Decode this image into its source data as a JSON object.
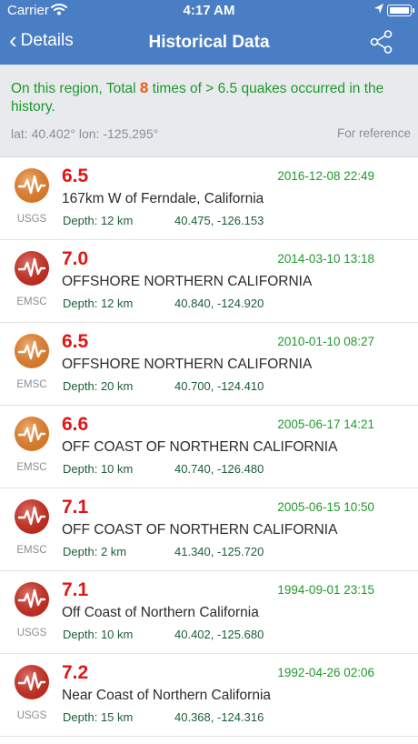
{
  "status_bar": {
    "carrier": "Carrier",
    "time": "4:17 AM"
  },
  "nav": {
    "back_label": "Details",
    "title": "Historical Data"
  },
  "summary": {
    "prefix": "On this region, Total",
    "count": "8",
    "suffix": "times of > 6.5 quakes occurred in the history.",
    "coords": "lat: 40.402°  lon: -125.295°",
    "reference": "For reference"
  },
  "colors": {
    "nav_bar": "#4a7ec4",
    "magnitude": "#e01515",
    "datetime": "#1e9a2a",
    "count": "#f05a10",
    "icon_orange": "#f5862a",
    "icon_red": "#d62c1e"
  },
  "quakes": [
    {
      "mag": "6.5",
      "datetime": "2016-12-08 22:49",
      "place": "167km W of Ferndale, California",
      "depth_label": "Depth:",
      "depth": "12 km",
      "location": "40.475, -126.153",
      "source": "USGS",
      "icon": "orange-quake-icon"
    },
    {
      "mag": "7.0",
      "datetime": "2014-03-10 13:18",
      "place": "OFFSHORE NORTHERN CALIFORNIA",
      "depth_label": "Depth:",
      "depth": "12 km",
      "location": "40.840, -124.920",
      "source": "EMSC",
      "icon": "red-quake-icon"
    },
    {
      "mag": "6.5",
      "datetime": "2010-01-10 08:27",
      "place": "OFFSHORE NORTHERN CALIFORNIA",
      "depth_label": "Depth:",
      "depth": "20 km",
      "location": "40.700, -124.410",
      "source": "EMSC",
      "icon": "orange-quake-icon"
    },
    {
      "mag": "6.6",
      "datetime": "2005-06-17 14:21",
      "place": "OFF COAST OF NORTHERN CALIFORNIA",
      "depth_label": "Depth:",
      "depth": "10 km",
      "location": "40.740, -126.480",
      "source": "EMSC",
      "icon": "orange-quake-icon"
    },
    {
      "mag": "7.1",
      "datetime": "2005-06-15 10:50",
      "place": "OFF COAST OF NORTHERN CALIFORNIA",
      "depth_label": "Depth:",
      "depth": "2 km",
      "location": "41.340, -125.720",
      "source": "EMSC",
      "icon": "red-quake-icon"
    },
    {
      "mag": "7.1",
      "datetime": "1994-09-01 23:15",
      "place": "Off Coast of Northern California",
      "depth_label": "Depth:",
      "depth": "10 km",
      "location": "40.402, -125.680",
      "source": "USGS",
      "icon": "red-quake-icon"
    },
    {
      "mag": "7.2",
      "datetime": "1992-04-26 02:06",
      "place": "Near Coast of Northern California",
      "depth_label": "Depth:",
      "depth": "15 km",
      "location": "40.368, -124.316",
      "source": "USGS",
      "icon": "red-quake-icon"
    }
  ]
}
